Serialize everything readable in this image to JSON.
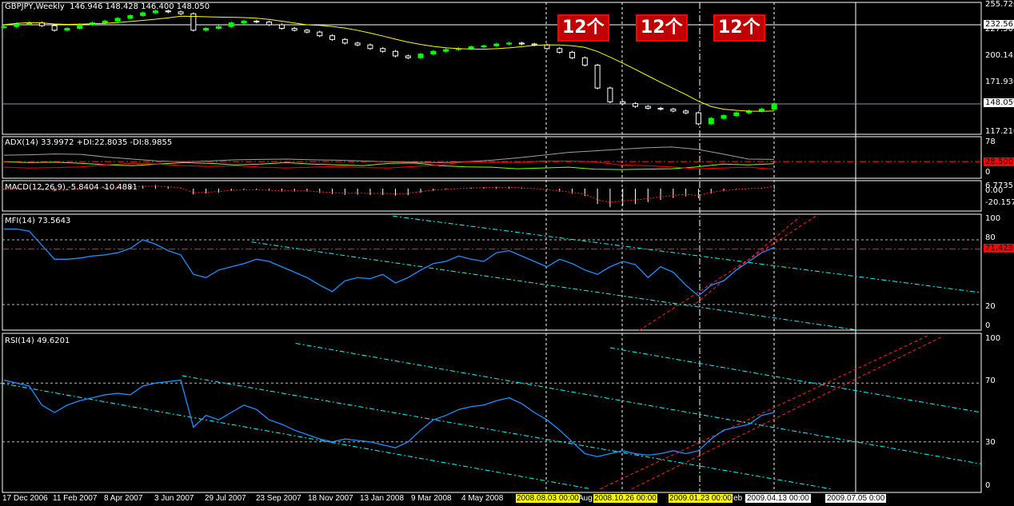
{
  "main": {
    "title": "GBPJPY,Weekly",
    "ohlc": "146.946 148.428 146.400 148.050",
    "price_ticks": [
      "255.720",
      "227.505",
      "200.145",
      "171.930",
      "117.210"
    ],
    "crosshair_price": "232.563",
    "current_price": "148.050",
    "closes": [
      232,
      235,
      236,
      233,
      228,
      230,
      234,
      236,
      238,
      241,
      244,
      247,
      249,
      248,
      246,
      228,
      230,
      232,
      236,
      238,
      237,
      234,
      230,
      228,
      226,
      222,
      218,
      214,
      212,
      208,
      205,
      200,
      198,
      202,
      205,
      207,
      208,
      210,
      211,
      213,
      214,
      213,
      212,
      208,
      204,
      198,
      190,
      165,
      150,
      148,
      145,
      143,
      142,
      140,
      138,
      126,
      132,
      135,
      138,
      140,
      142,
      148
    ],
    "price_range": [
      117.21,
      255.72
    ],
    "notes": [
      "12个",
      "12个",
      "12个"
    ]
  },
  "adx": {
    "label": "ADX(14) 33.9972 +DI:22.8035 -DI:8.9855",
    "ticks": [
      "78",
      "0"
    ],
    "level": "28.500",
    "range": [
      0,
      78
    ],
    "adx": [
      45,
      46,
      48,
      47,
      40,
      35,
      30,
      28,
      30,
      33,
      34,
      35,
      33,
      32,
      30,
      28,
      27,
      26,
      28,
      32,
      38,
      45,
      52,
      56,
      60,
      64,
      66,
      60,
      48,
      35,
      34
    ],
    "pdi": [
      28,
      26,
      27,
      24,
      20,
      18,
      22,
      26,
      24,
      20,
      22,
      26,
      22,
      20,
      18,
      24,
      25,
      18,
      15,
      14,
      10,
      12,
      14,
      9,
      8,
      9,
      10,
      15,
      22,
      20,
      23
    ],
    "mdi": [
      14,
      12,
      13,
      15,
      20,
      24,
      22,
      18,
      16,
      18,
      14,
      12,
      14,
      16,
      13,
      12,
      16,
      20,
      28,
      27,
      26,
      30,
      30,
      28,
      20,
      18,
      15,
      10,
      12,
      14,
      9
    ]
  },
  "macd": {
    "label": "MACD(12,26,9) -5.8404 -10.4881",
    "ticks": [
      "6.7735",
      "0.00",
      "-20.1572"
    ]
  },
  "mfi": {
    "label": "MFI(14) 73.5643",
    "ticks": [
      "100",
      "80",
      "20",
      "0"
    ],
    "level": "71.429",
    "values": [
      90,
      90,
      88,
      75,
      62,
      62,
      63,
      65,
      66,
      68,
      72,
      80,
      76,
      70,
      66,
      48,
      45,
      52,
      55,
      58,
      62,
      60,
      55,
      50,
      45,
      38,
      32,
      42,
      45,
      44,
      48,
      40,
      45,
      52,
      58,
      60,
      65,
      62,
      60,
      68,
      70,
      65,
      60,
      55,
      62,
      58,
      52,
      48,
      55,
      60,
      57,
      45,
      55,
      50,
      38,
      28,
      38,
      42,
      52,
      60,
      68,
      73
    ],
    "cyan_lines": [
      [
        [
          30.8,
          102
        ],
        [
          77.4,
          31
        ]
      ],
      [
        [
          19.6,
          78
        ],
        [
          67.8,
          -4
        ]
      ]
    ],
    "red_lines": [
      [
        [
          50.3,
          -4
        ],
        [
          64.3,
          102
        ]
      ],
      [
        [
          54.8,
          21
        ],
        [
          63.0,
          101
        ]
      ]
    ]
  },
  "rsi": {
    "label": "RSI(14) 49.6201",
    "ticks": [
      "100",
      "70",
      "30",
      "0"
    ],
    "values": [
      72,
      70,
      68,
      55,
      50,
      55,
      58,
      60,
      62,
      63,
      62,
      68,
      70,
      71,
      72,
      40,
      48,
      45,
      50,
      55,
      52,
      45,
      42,
      38,
      35,
      32,
      30,
      32,
      31,
      30,
      28,
      26,
      30,
      38,
      45,
      48,
      52,
      54,
      55,
      58,
      60,
      56,
      50,
      45,
      38,
      30,
      22,
      20,
      22,
      24,
      22,
      21,
      22,
      24,
      22,
      24,
      32,
      38,
      40,
      42,
      48,
      50
    ],
    "cyan_lines": [
      [
        [
          23.1,
          97
        ],
        [
          77.4,
          15
        ]
      ],
      [
        [
          14.1,
          75
        ],
        [
          65.5,
          -2
        ]
      ],
      [
        [
          -0.3,
          70
        ],
        [
          46.5,
          -2
        ]
      ],
      [
        [
          48,
          94
        ],
        [
          77.4,
          50
        ]
      ]
    ],
    "red_lines": [
      [
        [
          47.2,
          -2
        ],
        [
          73.1,
          102
        ]
      ],
      [
        [
          49.7,
          -2
        ],
        [
          74.4,
          102
        ]
      ]
    ]
  },
  "time_axis": {
    "labels": [
      "17 Dec 2006",
      "11 Feb 2007",
      "8 Apr 2007",
      "3 Jun 2007",
      "29 Jul 2007",
      "23 Sep 2007",
      "18 Nov 2007",
      "13 Jan 2008",
      "9 Mar 2008",
      "4 May 2008",
      "Aug",
      "Feb 20"
    ],
    "markers": [
      "2008.08.03 00:00",
      "2008.10.26 00:00",
      "2009.01.23 00:00",
      "2009.04.13 00:00",
      "2009.07.05 0:00"
    ]
  },
  "colors": {
    "bull": "#00ff00",
    "bear": "#ffffff",
    "ma": "#ffff00",
    "adx": "#a0a0a0",
    "pdi": "#7fff00",
    "mdi": "#ff0000",
    "osc": "#1e90ff",
    "cyan": "#00ffff",
    "red": "#ff2020"
  }
}
